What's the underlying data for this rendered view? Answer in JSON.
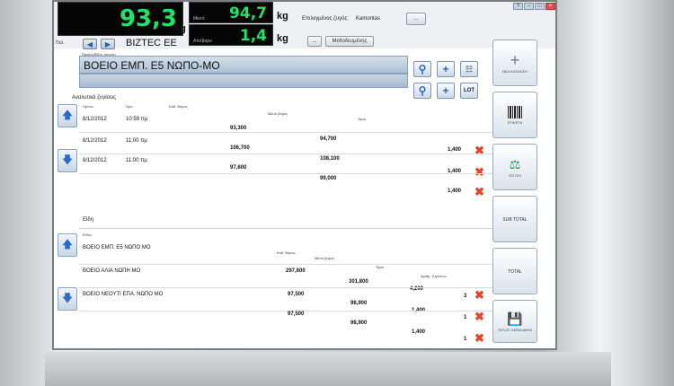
{
  "scale": {
    "weight": "93,3",
    "weight_unit": "kg",
    "tare": "94,7",
    "tare_unit": "kg",
    "net": "1,4",
    "net_unit": "kg",
    "tare_label": "Μικτό",
    "net_label": "Απόβαρο",
    "scale_select_label": "Επιλεγμένος ζυγός:",
    "scale_select_value": "Kamontas",
    "browse_label": "...",
    "nav_label": "...",
    "exit_label": "Μεθοδευμένης"
  },
  "customer": {
    "label": "Πελ.",
    "name": "BIZTEC EE",
    "prev": "◀",
    "next": "▶"
  },
  "item": {
    "sublabel": "Προϊόν/Είδος σύνολο",
    "name": "ΒΟΕΙΟ ΕΜΠ. Ε5 ΝΩΠΟ-ΜΟ",
    "lot_label": "LOT"
  },
  "weighings": {
    "title": "Αναλυτικά ζυγίσεις",
    "headers": [
      "Ημ/νία",
      "Ώρα",
      "Καθ. Βάρος",
      "Μικτό βάρος",
      "Τάρα"
    ],
    "rows": [
      {
        "date": "8/12/2012",
        "time": "10:59 πμ",
        "net": "93,300",
        "gross": "94,700",
        "tare": "1,400"
      },
      {
        "date": "8/12/2012",
        "time": "11:00 πμ",
        "net": "106,700",
        "gross": "108,100",
        "tare": "1,400"
      },
      {
        "date": "8/12/2012",
        "time": "11:00 πμ",
        "net": "97,600",
        "gross": "99,000",
        "tare": "1,400"
      }
    ]
  },
  "items": {
    "title": "Είδη",
    "header": "Είδος",
    "col_headers": [
      "Καθ. Βάρος",
      "Μικτό βάρος",
      "Τάρα",
      "Αριθμ. ζυγίσεων"
    ],
    "rows": [
      {
        "name": "ΒΟΕΙΟ ΕΜΠ. Ε5 ΝΩΠΟ ΜΟ",
        "net": "297,600",
        "gross": "301,800",
        "tare": "4,200",
        "count": "3"
      },
      {
        "name": "ΒΟΕΙΟ ΑΛΙΑ ΝΩΠΗ ΜΟ",
        "net": "97,500",
        "gross": "98,900",
        "tare": "1,400",
        "count": "1"
      },
      {
        "name": "ΒΟΕΙΟ ΝΕΟΥΤΙ ΕΠΑ. ΝΩΠΟ ΜΟ",
        "net": "97,500",
        "gross": "98,900",
        "tare": "1,400",
        "count": "1"
      }
    ]
  },
  "right_panel": {
    "new_label": "ΝΕΑ ΚΑΤΑΧ/ΣΗ",
    "label_print": "ΕΤΙΚΕΤΑ",
    "weigh_label": "ΖΥΓΙΣΗ",
    "subtotal": "SUB TOTAL",
    "total": "TOTAL",
    "save_label": "ΤΕΛΟΣ ΠΑΡΑΛΑΒΗΣ"
  },
  "colors": {
    "lcd_text": "#22e06a",
    "delete": "#e0462a",
    "accent": "#2a6cc2"
  },
  "icons": {
    "add": "plus-icon",
    "search": "search-icon",
    "delete": "delete-x-icon",
    "up": "arrow-up-icon",
    "down": "arrow-down-icon",
    "barcode": "barcode-icon",
    "scale": "scale-icon",
    "save": "floppy-disk-icon",
    "exit": "exit-icon"
  }
}
